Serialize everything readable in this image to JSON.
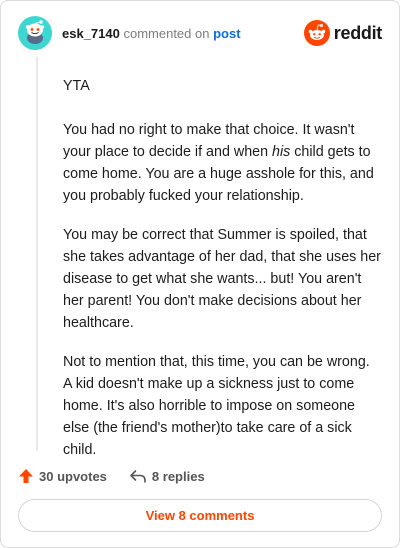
{
  "header": {
    "username": "esk_7140",
    "action_text": "commented on",
    "post_link": "post",
    "brand_word": "reddit"
  },
  "comment": {
    "p1": "YTA",
    "p2_before": "You had no right to make that choice. It wasn't your place to decide if and when ",
    "p2_emph": "his",
    "p2_after": " child gets to come home. You are a huge asshole for this, and you probably fucked your relationship.",
    "p3": "You may be correct that Summer is spoiled, that she takes advantage of her dad, that she uses her disease to get what she wants... but! You aren't her parent! You don't make decisions about her healthcare.",
    "p4": "Not to mention that, this time, you can be wrong. A kid doesn't make up a sickness just to come home. It's also horrible to impose on someone else (the friend's mother)to take care of a sick child."
  },
  "actions": {
    "upvotes": "30 upvotes",
    "replies": "8 replies"
  },
  "view_button": "View 8 comments",
  "colors": {
    "accent": "#ff4500",
    "avatar_bg": "#3dd6d0",
    "link": "#0b6fd6"
  },
  "icons": {
    "avatar": "snoo-avatar-icon",
    "brand": "reddit-logo-icon",
    "upvote": "upvote-arrow-icon",
    "reply": "reply-arrow-icon"
  }
}
